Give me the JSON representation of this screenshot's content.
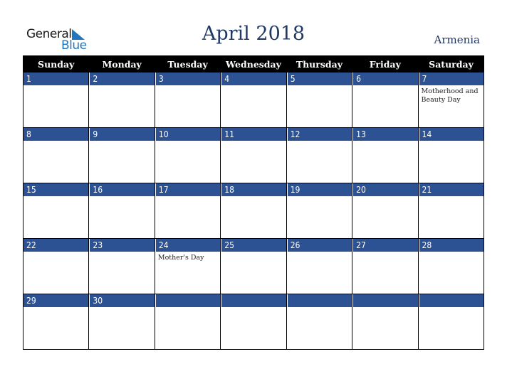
{
  "logo": {
    "text1": "General",
    "text2": "Blue"
  },
  "title": "April 2018",
  "country": "Armenia",
  "colors": {
    "header_bg": "#000000",
    "day_bar": "#2c5293",
    "title": "#1f3864",
    "logo_blue": "#2077c0"
  },
  "weekdays": [
    "Sunday",
    "Monday",
    "Tuesday",
    "Wednesday",
    "Thursday",
    "Friday",
    "Saturday"
  ],
  "weeks": [
    [
      {
        "day": "1",
        "event": ""
      },
      {
        "day": "2",
        "event": ""
      },
      {
        "day": "3",
        "event": ""
      },
      {
        "day": "4",
        "event": ""
      },
      {
        "day": "5",
        "event": ""
      },
      {
        "day": "6",
        "event": ""
      },
      {
        "day": "7",
        "event": "Motherhood and Beauty Day"
      }
    ],
    [
      {
        "day": "8",
        "event": ""
      },
      {
        "day": "9",
        "event": ""
      },
      {
        "day": "10",
        "event": ""
      },
      {
        "day": "11",
        "event": ""
      },
      {
        "day": "12",
        "event": ""
      },
      {
        "day": "13",
        "event": ""
      },
      {
        "day": "14",
        "event": ""
      }
    ],
    [
      {
        "day": "15",
        "event": ""
      },
      {
        "day": "16",
        "event": ""
      },
      {
        "day": "17",
        "event": ""
      },
      {
        "day": "18",
        "event": ""
      },
      {
        "day": "19",
        "event": ""
      },
      {
        "day": "20",
        "event": ""
      },
      {
        "day": "21",
        "event": ""
      }
    ],
    [
      {
        "day": "22",
        "event": ""
      },
      {
        "day": "23",
        "event": ""
      },
      {
        "day": "24",
        "event": "Mother's Day"
      },
      {
        "day": "25",
        "event": ""
      },
      {
        "day": "26",
        "event": ""
      },
      {
        "day": "27",
        "event": ""
      },
      {
        "day": "28",
        "event": ""
      }
    ],
    [
      {
        "day": "29",
        "event": ""
      },
      {
        "day": "30",
        "event": ""
      },
      {
        "day": "",
        "event": ""
      },
      {
        "day": "",
        "event": ""
      },
      {
        "day": "",
        "event": ""
      },
      {
        "day": "",
        "event": ""
      },
      {
        "day": "",
        "event": ""
      }
    ]
  ]
}
